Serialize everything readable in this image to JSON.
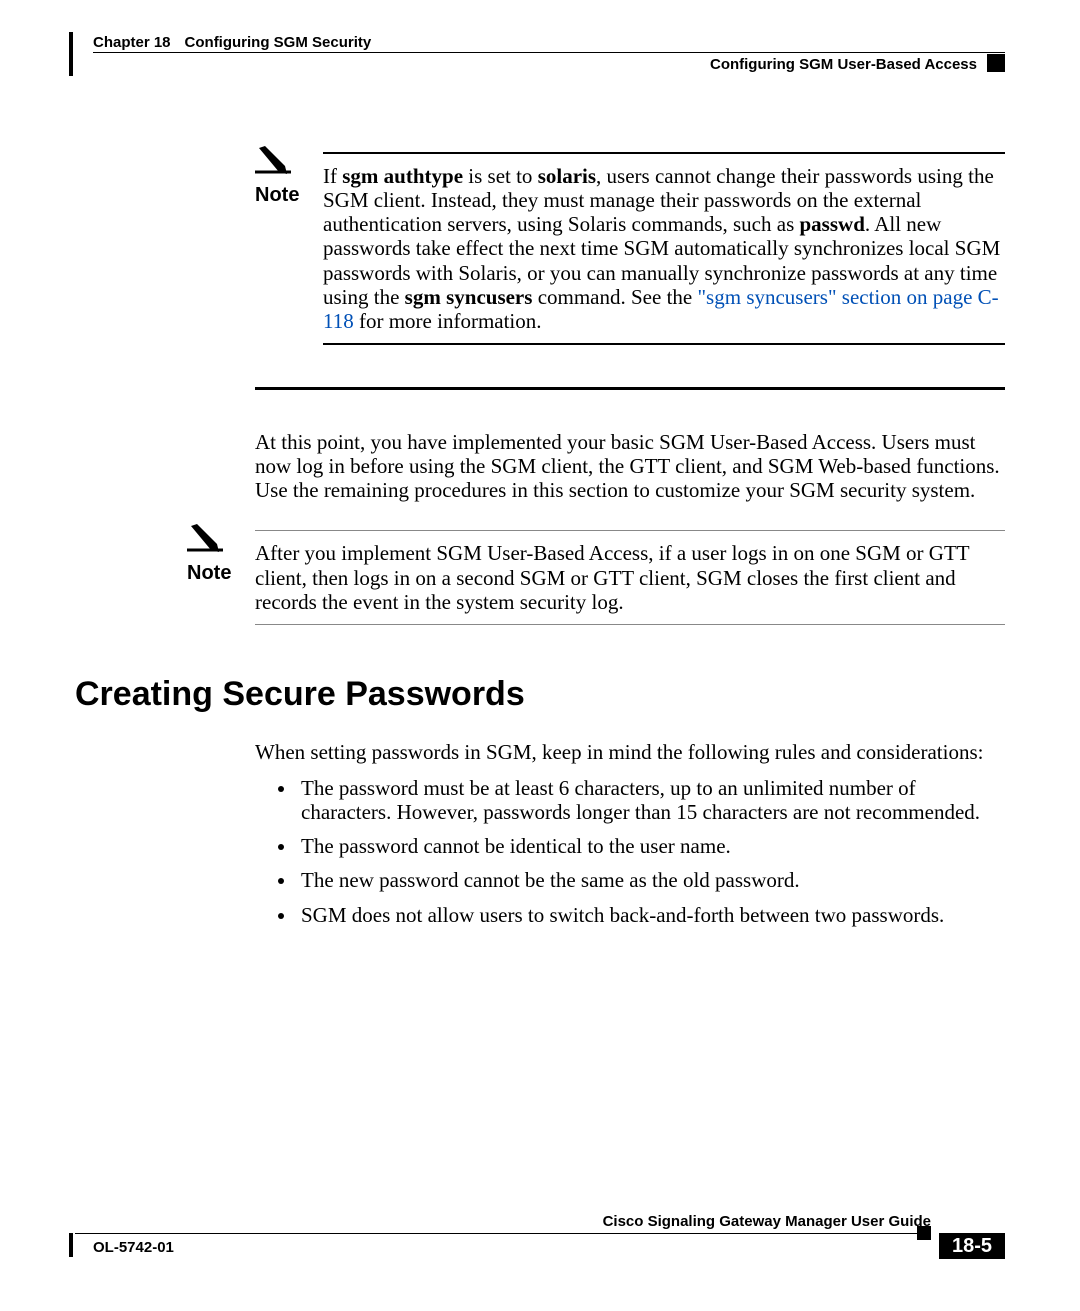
{
  "header": {
    "chapter_label": "Chapter 18",
    "chapter_title": "Configuring SGM Security",
    "section_title": "Configuring SGM User-Based Access"
  },
  "note1": {
    "label": "Note",
    "prefix": "If ",
    "cmd1": "sgm authtype",
    "mid1": " is set to ",
    "cmd2": "solaris",
    "text1": ", users cannot change their passwords using the SGM client. Instead, they must manage their passwords on the external authentication servers, using Solaris commands, such as ",
    "cmd3": "passwd",
    "text2": ". All new passwords take effect the next time SGM automatically synchronizes local SGM passwords with Solaris, or you can manually synchronize passwords at any time using the ",
    "cmd4": "sgm syncusers",
    "text3": " command. See the ",
    "link": "\"sgm syncusers\" section on page C-118",
    "text4": " for more information."
  },
  "para1": "At this point, you have implemented your basic SGM User-Based Access. Users must now log in before using the SGM client, the GTT client, and SGM Web-based functions. Use the remaining procedures in this section to customize your SGM security system.",
  "note2": {
    "label": "Note",
    "text": "After you implement SGM User-Based Access, if a user logs in on one SGM or GTT client, then logs in on a second SGM or GTT client, SGM closes the first client and records the event in the system security log."
  },
  "heading": "Creating Secure Passwords",
  "para2": "When setting passwords in SGM, keep in mind the following rules and considerations:",
  "rules": [
    "The password must be at least 6 characters, up to an unlimited number of characters. However, passwords longer than 15 characters are not recommended.",
    "The password cannot be identical to the user name.",
    "The new password cannot be the same as the old password.",
    "SGM does not allow users to switch back-and-forth between two passwords."
  ],
  "footer": {
    "book_title": "Cisco Signaling Gateway Manager User Guide",
    "doc_id": "OL-5742-01",
    "page": "18-5"
  }
}
